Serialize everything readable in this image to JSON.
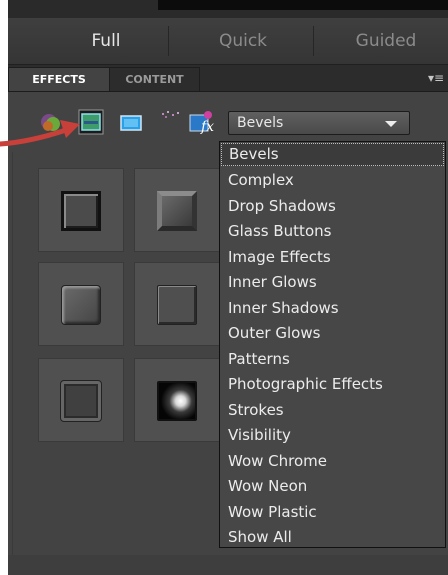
{
  "modes": [
    {
      "label": "Full",
      "active": true
    },
    {
      "label": "Quick",
      "active": false
    },
    {
      "label": "Guided",
      "active": false
    }
  ],
  "panel_tabs": {
    "effects": "EFFECTS",
    "content": "CONTENT",
    "menu_icon": "panel-menu-icon"
  },
  "toolbar": {
    "icons": [
      "layer-styles-icon",
      "photo-effects-icon",
      "filters-icon",
      "frame-icon",
      "fx-icon"
    ]
  },
  "category_select": {
    "value": "Bevels",
    "options": [
      "Bevels",
      "Complex",
      "Drop Shadows",
      "Glass Buttons",
      "Image Effects",
      "Inner Glows",
      "Inner Shadows",
      "Outer Glows",
      "Patterns",
      "Photographic Effects",
      "Strokes",
      "Visibility",
      "Wow Chrome",
      "Wow Neon",
      "Wow Plastic",
      "Show All"
    ]
  },
  "thumbnails": [
    "bevel-thumbnail",
    "bevel-thumbnail",
    "bevel-thumbnail",
    "bevel-thumbnail",
    "bevel-thumbnail",
    "bevel-thumbnail"
  ],
  "colors": {
    "panel_bg": "#434343",
    "annotation_arrow": "#c8403a"
  }
}
